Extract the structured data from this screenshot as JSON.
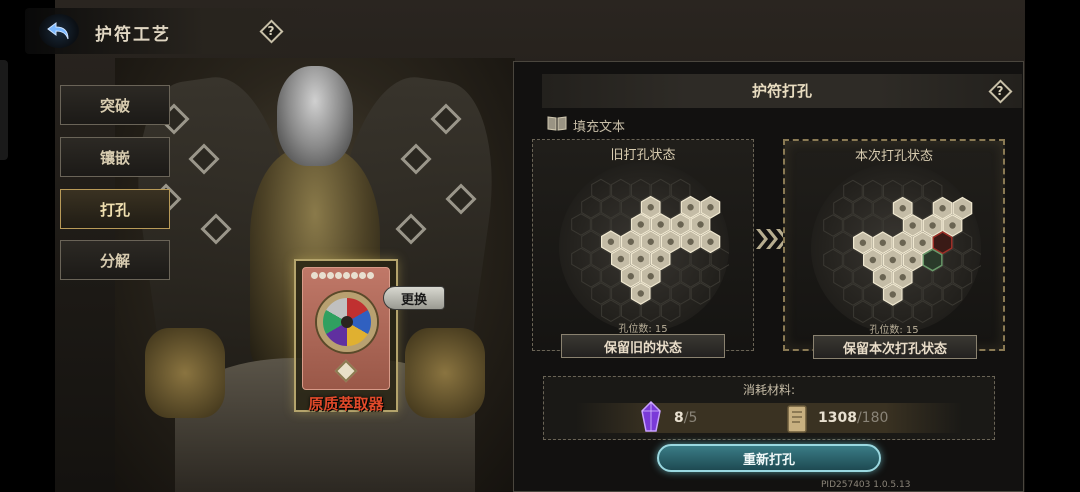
{
  "header": {
    "title": "护符工艺",
    "help": "?"
  },
  "tabs": [
    {
      "label": "突破",
      "active": false
    },
    {
      "label": "镶嵌",
      "active": false
    },
    {
      "label": "打孔",
      "active": true
    },
    {
      "label": "分解",
      "active": false
    }
  ],
  "card": {
    "name": "原质萃取器",
    "swap_label": "更换",
    "stars": 8
  },
  "panel": {
    "title": "护符打孔",
    "help": "?",
    "fill_text": "填充文本",
    "old_state": {
      "title": "旧打孔状态",
      "slots_label": "孔位数: 15",
      "button_label": "保留旧的状态"
    },
    "new_state": {
      "title": "本次打孔状态",
      "slots_label": "孔位数: 15",
      "button_label": "保留本次打孔状态"
    },
    "cost": {
      "title": "消耗材料:",
      "items": [
        {
          "icon": "purple-crystal-icon",
          "have": "8",
          "need": "/5"
        },
        {
          "icon": "scroll-icon",
          "have": "1308",
          "need": "/180"
        }
      ]
    },
    "rehole_label": "重新打孔",
    "version": "PID257403  1.0.5.13"
  },
  "colors": {
    "accent": "#b89a58",
    "card_name": "#e24a2a",
    "cta": "#3a7c86"
  }
}
